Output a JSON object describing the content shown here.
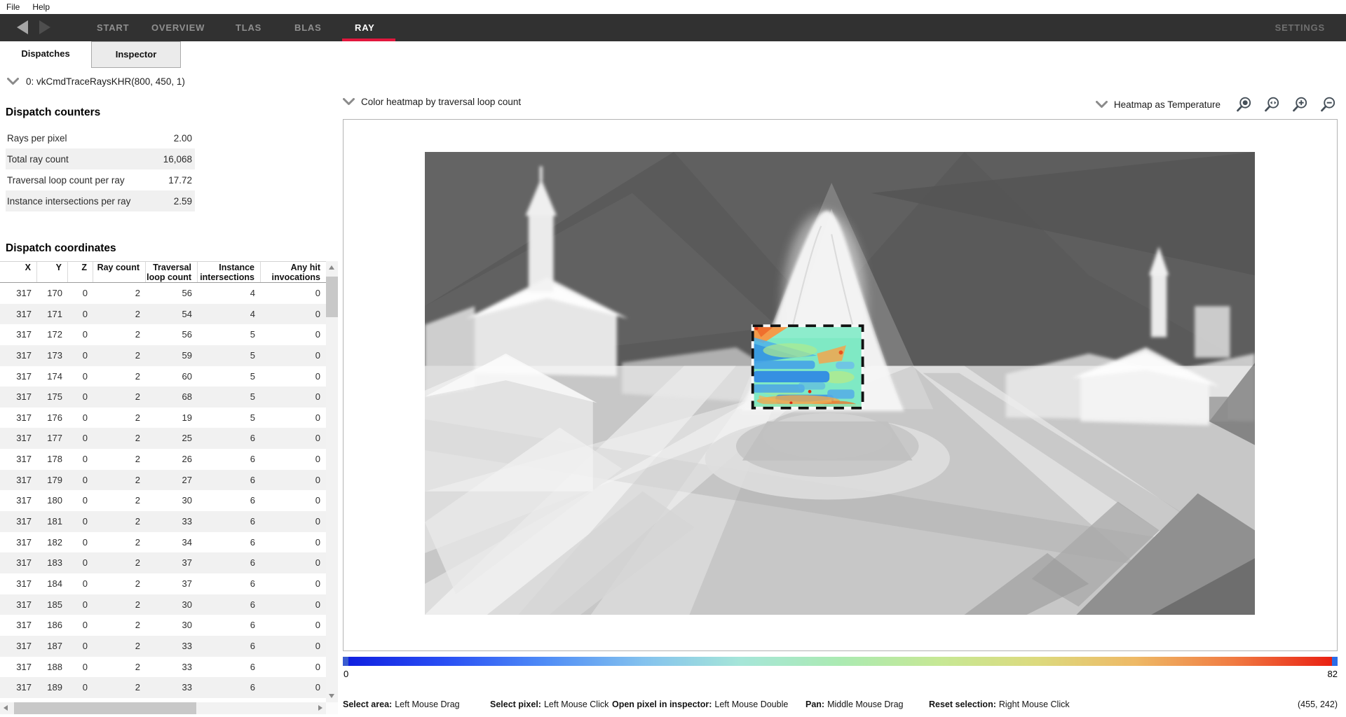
{
  "menu": {
    "items": [
      {
        "label": "File"
      },
      {
        "label": "Help"
      }
    ]
  },
  "nav": {
    "tabs": [
      {
        "label": "START"
      },
      {
        "label": "OVERVIEW"
      },
      {
        "label": "TLAS"
      },
      {
        "label": "BLAS"
      },
      {
        "label": "RAY",
        "active": true
      }
    ],
    "settings_label": "SETTINGS",
    "accent_color": "#e2173d"
  },
  "subtabs": {
    "dispatches": "Dispatches",
    "inspector": "Inspector"
  },
  "dispatch_selector": "0: vkCmdTraceRaysKHR(800, 450, 1)",
  "counters": {
    "title": "Dispatch counters",
    "rows": [
      {
        "label": "Rays per pixel",
        "value": "2.00"
      },
      {
        "label": "Total ray count",
        "value": "16,068"
      },
      {
        "label": "Traversal loop count per ray",
        "value": "17.72"
      },
      {
        "label": "Instance intersections per ray",
        "value": "2.59"
      }
    ]
  },
  "coordinates": {
    "title": "Dispatch coordinates",
    "headers": [
      {
        "top": "X",
        "bottom": ""
      },
      {
        "top": "Y",
        "bottom": ""
      },
      {
        "top": "Z",
        "bottom": ""
      },
      {
        "top": "Ray count",
        "bottom": ""
      },
      {
        "top": "Traversal",
        "bottom": "loop count"
      },
      {
        "top": "Instance",
        "bottom": "intersections"
      },
      {
        "top": "Any hit",
        "bottom": "invocations"
      }
    ],
    "rows": [
      [
        "317",
        "170",
        "0",
        "2",
        "56",
        "4",
        "0"
      ],
      [
        "317",
        "171",
        "0",
        "2",
        "54",
        "4",
        "0"
      ],
      [
        "317",
        "172",
        "0",
        "2",
        "56",
        "5",
        "0"
      ],
      [
        "317",
        "173",
        "0",
        "2",
        "59",
        "5",
        "0"
      ],
      [
        "317",
        "174",
        "0",
        "2",
        "60",
        "5",
        "0"
      ],
      [
        "317",
        "175",
        "0",
        "2",
        "68",
        "5",
        "0"
      ],
      [
        "317",
        "176",
        "0",
        "2",
        "19",
        "5",
        "0"
      ],
      [
        "317",
        "177",
        "0",
        "2",
        "25",
        "6",
        "0"
      ],
      [
        "317",
        "178",
        "0",
        "2",
        "26",
        "6",
        "0"
      ],
      [
        "317",
        "179",
        "0",
        "2",
        "27",
        "6",
        "0"
      ],
      [
        "317",
        "180",
        "0",
        "2",
        "30",
        "6",
        "0"
      ],
      [
        "317",
        "181",
        "0",
        "2",
        "33",
        "6",
        "0"
      ],
      [
        "317",
        "182",
        "0",
        "2",
        "34",
        "6",
        "0"
      ],
      [
        "317",
        "183",
        "0",
        "2",
        "37",
        "6",
        "0"
      ],
      [
        "317",
        "184",
        "0",
        "2",
        "37",
        "6",
        "0"
      ],
      [
        "317",
        "185",
        "0",
        "2",
        "30",
        "6",
        "0"
      ],
      [
        "317",
        "186",
        "0",
        "2",
        "30",
        "6",
        "0"
      ],
      [
        "317",
        "187",
        "0",
        "2",
        "33",
        "6",
        "0"
      ],
      [
        "317",
        "188",
        "0",
        "2",
        "33",
        "6",
        "0"
      ],
      [
        "317",
        "189",
        "0",
        "2",
        "33",
        "6",
        "0"
      ]
    ]
  },
  "viewer": {
    "heatmap_dropdown": "Color heatmap by traversal loop count",
    "color_mode_dropdown": "Heatmap as Temperature",
    "zoom_icons": [
      "zoom-to-selection",
      "zoom-reset",
      "zoom-in",
      "zoom-out"
    ],
    "legend": {
      "min": "0",
      "max": "82",
      "left_handle_color": "#3a5cd0",
      "right_handle_color": "#2b6de8",
      "stops": [
        "#1020e0",
        "#2a50f4",
        "#4f8cf6",
        "#84c2ee",
        "#a6e6d8",
        "#abeab2",
        "#c6e895",
        "#dcda7e",
        "#eeb966",
        "#f07b42",
        "#e92012"
      ]
    },
    "help": [
      {
        "label": "Select area:",
        "value": "Left Mouse Drag"
      },
      {
        "label": "Select pixel:",
        "value": "Left Mouse Click"
      },
      {
        "label": "Open pixel in inspector:",
        "value": "Left Mouse Double"
      },
      {
        "label": "Pan:",
        "value": "Middle Mouse Drag"
      },
      {
        "label": "Reset selection:",
        "value": "Right Mouse Click"
      }
    ],
    "cursor_position": "(455, 242)"
  }
}
